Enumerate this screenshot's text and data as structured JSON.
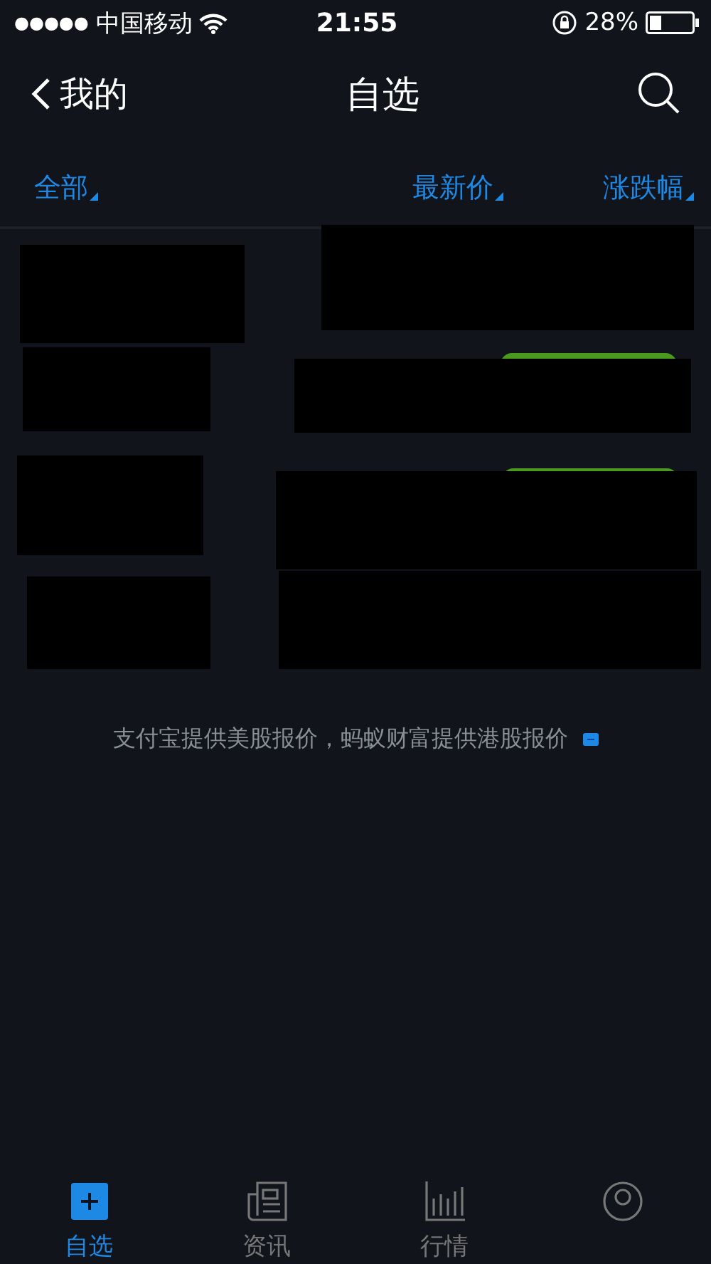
{
  "status_bar": {
    "signal_dots": "●●●●●",
    "carrier": "中国移动",
    "time": "21:55",
    "battery": "28%"
  },
  "nav": {
    "back": "我的",
    "title": "自选"
  },
  "columns": [
    {
      "label": "全部"
    },
    {
      "label": "最新价"
    },
    {
      "label": "涨跌幅"
    }
  ],
  "rows": [
    {
      "kind": "redacted",
      "badge_visible": false
    },
    {
      "kind": "redacted",
      "badge_visible": true
    },
    {
      "kind": "redacted",
      "badge_visible": true
    },
    {
      "kind": "redacted",
      "badge_visible": false
    }
  ],
  "note": "支付宝提供美股报价，蚂蚁财富提供港股报价",
  "tabs": [
    {
      "label": "自选",
      "selected": true
    },
    {
      "label": "资讯",
      "selected": false
    },
    {
      "label": "行情",
      "selected": false
    },
    {
      "selected": false
    }
  ]
}
